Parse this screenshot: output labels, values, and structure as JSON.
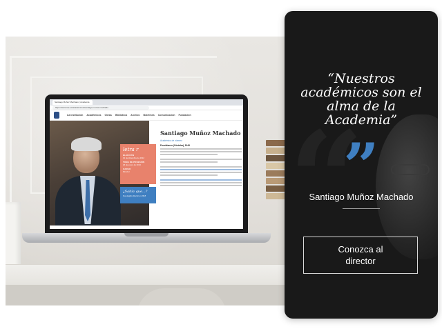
{
  "browser": {
    "tab_title": "Santiago Muñoz Machado | Academia",
    "url": "https://www.rae.es/academicos/santiago-munoz-machado"
  },
  "site": {
    "nav": [
      "La institución",
      "Académicos",
      "Obras",
      "Biblioteca",
      "Archivo",
      "Boletines",
      "Comunicación",
      "Fundación"
    ],
    "card_letter": "letra r",
    "election_label": "ELECCIÓN",
    "election_value": "13 de diciembre de 2012",
    "possession_label": "TOMA DE POSESIÓN",
    "possession_value": "26 de enero de 2013",
    "post_label": "CARGO",
    "post_value": "Director",
    "blue_card_title": "¿Sabía que...?",
    "blue_card_sub": "Fue elegido director en 2018",
    "name": "Santiago Muñoz Machado",
    "role": "Académico de número",
    "birth": "Pozoblanco (Córdoba), 1949"
  },
  "card": {
    "quote": "“Nuestros académicos son el alma de la Academia”",
    "quote_mark": "”",
    "director_name": "Santiago Muñoz Machado",
    "cta_label": "Conozca al director"
  },
  "colors": {
    "accent_blue": "#3f7fc1",
    "card_bg": "#191919",
    "salmon": "#e8826c"
  }
}
